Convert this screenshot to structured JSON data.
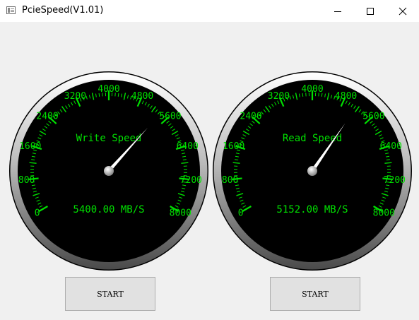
{
  "window": {
    "title": "PcieSpeed(V1.01)",
    "icons": [
      "app-icon",
      "minimize-icon",
      "maximize-icon",
      "close-icon"
    ]
  },
  "gauges": [
    {
      "name": "write",
      "label": "Write Speed",
      "readout": "5400.00 MB/S",
      "value": 5400,
      "scale_labels": [
        "0",
        "800",
        "1600",
        "2400",
        "3200",
        "4000",
        "4800",
        "5600",
        "6400",
        "7200",
        "8000"
      ]
    },
    {
      "name": "read",
      "label": "Read Speed",
      "readout": "5152.00 MB/S",
      "value": 5152,
      "scale_labels": [
        "0",
        "800",
        "1600",
        "2400",
        "3200",
        "4000",
        "4800",
        "5600",
        "6400",
        "7200",
        "8000"
      ]
    }
  ],
  "scale": {
    "min": 0,
    "max": 8000
  },
  "buttons": {
    "write_start": "START",
    "read_start": "START"
  },
  "colors": {
    "dial": "#000000",
    "scale": "#00e000",
    "needle": "#ffffff",
    "window": "#f0f0f0"
  }
}
